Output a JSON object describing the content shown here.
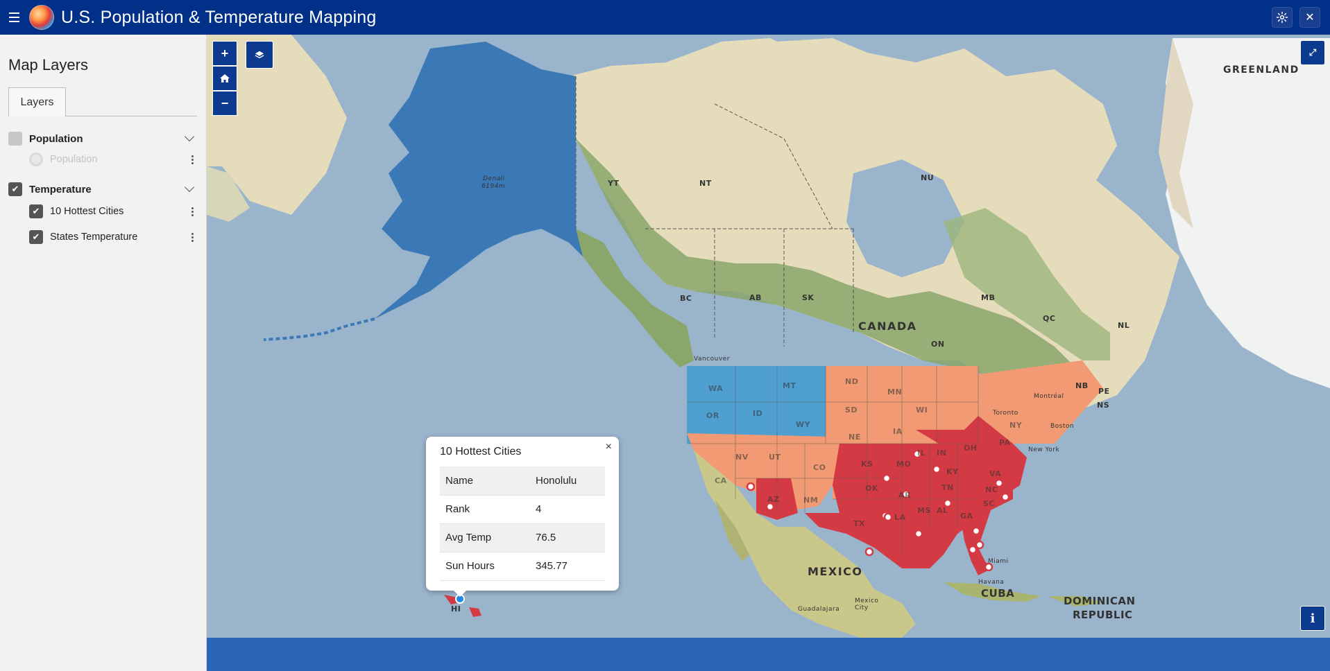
{
  "app": {
    "title": "U.S. Population & Temperature Mapping",
    "menu_icon": "hamburger-icon",
    "settings_icon": "gear-icon",
    "close_icon": "close-icon"
  },
  "sidebar": {
    "title": "Map Layers",
    "tab_label": "Layers",
    "groups": [
      {
        "label": "Population",
        "checked": false,
        "layers": [
          {
            "label": "Population",
            "control": "radio",
            "enabled": false
          }
        ]
      },
      {
        "label": "Temperature",
        "checked": true,
        "layers": [
          {
            "label": "10 Hottest Cities",
            "control": "checkbox",
            "checked": true
          },
          {
            "label": "States Temperature",
            "control": "checkbox",
            "checked": true
          }
        ]
      }
    ]
  },
  "map": {
    "controls": {
      "zoom_in": "+",
      "home_icon": "home-icon",
      "zoom_out": "−",
      "layers_icon": "layers-icon",
      "fullscreen_icon": "fullscreen-icon",
      "info": "i"
    },
    "labels": {
      "greenland": "GREENLAND",
      "canada": "CANADA",
      "mexico": "MEXICO",
      "cuba": "CUBA",
      "dominican": "DOMINICAN",
      "republic": "REPUBLIC",
      "yt": "YT",
      "nt": "NT",
      "nu": "NU",
      "bc": "BC",
      "ab": "AB",
      "sk": "SK",
      "mb": "MB",
      "on": "ON",
      "qc": "QC",
      "nl": "NL",
      "nb": "NB",
      "pe": "PE",
      "ns": "NS",
      "hi": "HI",
      "wa": "WA",
      "or": "OR",
      "ca": "CA",
      "nv": "NV",
      "id": "ID",
      "mt": "MT",
      "wy": "WY",
      "ut": "UT",
      "az": "AZ",
      "co": "CO",
      "nm": "NM",
      "nd": "ND",
      "sd": "SD",
      "ne": "NE",
      "ks": "KS",
      "ok": "OK",
      "tx": "TX",
      "mn": "MN",
      "ia": "IA",
      "mo": "MO",
      "ar": "AR",
      "la": "LA",
      "wi": "WI",
      "il": "IL",
      "in": "IN",
      "oh": "OH",
      "ky": "KY",
      "tn": "TN",
      "ms": "MS",
      "al": "AL",
      "ga": "GA",
      "sc": "SC",
      "nc": "NC",
      "va": "VA",
      "pa": "PA",
      "ny": "NY",
      "denali": "Denali",
      "denali_elev": "6194m",
      "vancouver": "Vancouver",
      "toronto": "Toronto",
      "montreal": "Montréal",
      "boston": "Boston",
      "new_york": "New York",
      "miami": "Miami",
      "havana": "Havana",
      "guadalajara": "Guadalajara",
      "mexico_city": "Mexico City"
    },
    "legend_colors": {
      "cool": "#4f9fd1",
      "warm": "#f19a73",
      "hot": "#d33a44",
      "alaska": "#3a79b6"
    }
  },
  "popup": {
    "title": "10 Hottest Cities",
    "close": "×",
    "rows": [
      {
        "key": "Name",
        "value": "Honolulu"
      },
      {
        "key": "Rank",
        "value": "4"
      },
      {
        "key": "Avg Temp",
        "value": "76.5"
      },
      {
        "key": "Sun Hours",
        "value": "345.77"
      }
    ]
  }
}
